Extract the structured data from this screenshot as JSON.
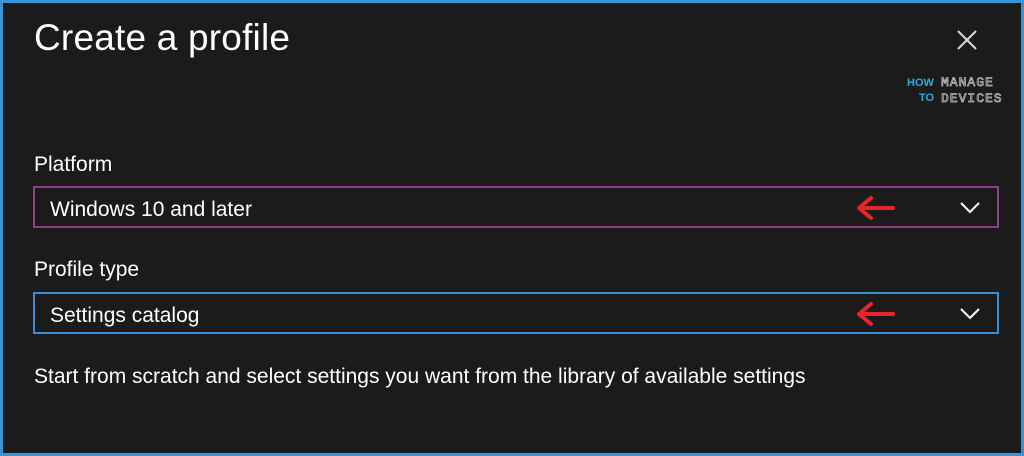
{
  "dialog": {
    "title": "Create a profile",
    "close_icon": "close-icon"
  },
  "logo": {
    "how": "HOW",
    "to": "TO",
    "manage": "MANAGE",
    "devices": "DEVICES"
  },
  "platform": {
    "label": "Platform",
    "value": "Windows 10 and later",
    "icon": "chevron-down-icon",
    "annotation": "arrow-left-icon"
  },
  "profile_type": {
    "label": "Profile type",
    "value": "Settings catalog",
    "icon": "chevron-down-icon",
    "annotation": "arrow-left-icon"
  },
  "description": "Start from scratch and select settings you want from the library of available settings",
  "colors": {
    "background": "#1b1b1b",
    "outer_border": "#3a93d6",
    "platform_border": "#8b3f8e",
    "profile_border": "#3a8fd8",
    "annotation_arrow": "#e8262a",
    "logo_cyan": "#2fa8e0"
  }
}
